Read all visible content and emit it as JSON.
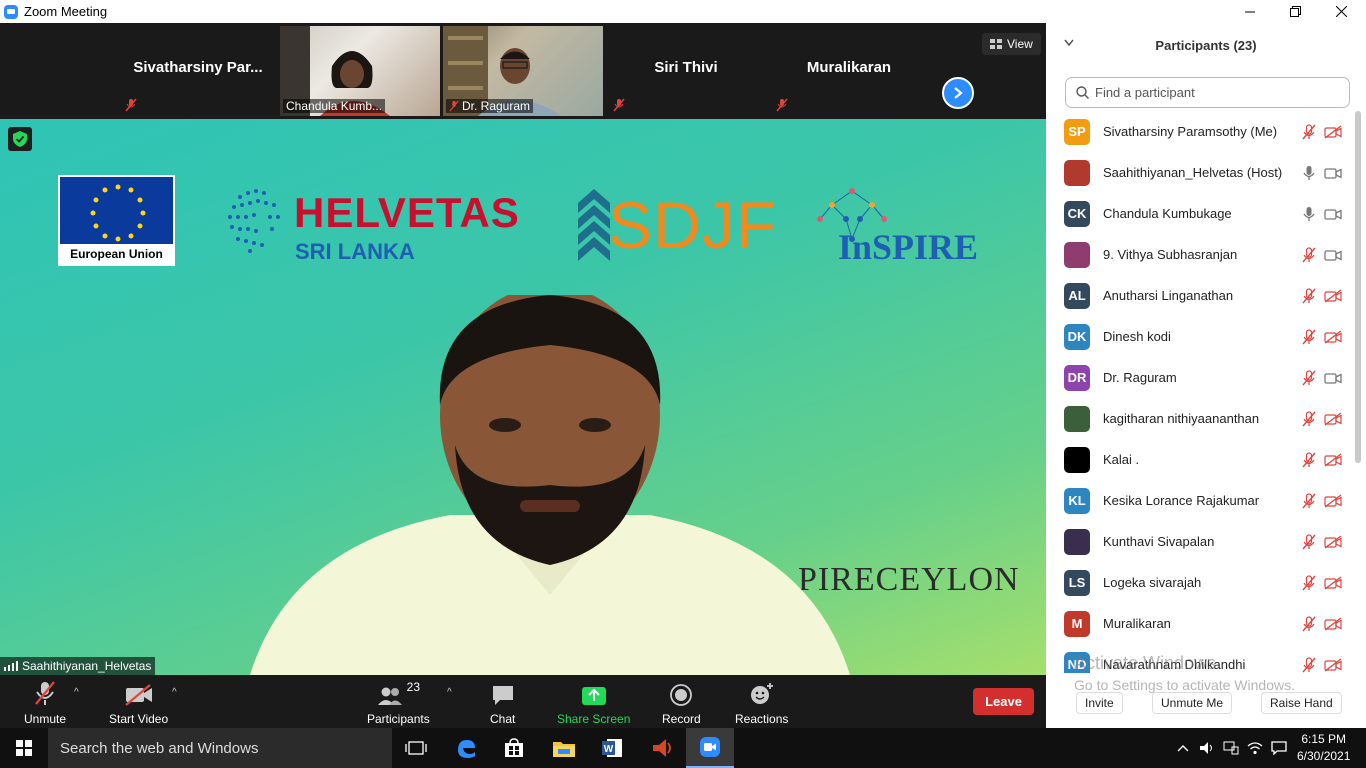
{
  "window": {
    "title": "Zoom Meeting"
  },
  "strip": {
    "tiles": [
      {
        "name": "Sivatharsiny  Par..."
      },
      {
        "label": "Chandula Kumb..."
      },
      {
        "label": "Dr. Raguram"
      },
      {
        "name": "Siri Thivi"
      },
      {
        "name": "Muralikaran"
      }
    ],
    "view_label": "View"
  },
  "stage": {
    "eu_label": "European Union",
    "helvetas_title": "HELVETAS",
    "helvetas_sub": "SRI LANKA",
    "sdjf": "SDJF",
    "inspire": "InSPIRE",
    "banner_text": "PIRECEYLON",
    "speaker_name": "Saahithiyanan_Helvetas"
  },
  "toolbar": {
    "unmute": "Unmute",
    "start_video": "Start Video",
    "participants": "Participants",
    "participants_count": "23",
    "chat": "Chat",
    "share_screen": "Share Screen",
    "record": "Record",
    "reactions": "Reactions",
    "leave": "Leave"
  },
  "panel": {
    "title": "Participants (23)",
    "search_placeholder": "Find a participant",
    "participants": [
      {
        "initials": "SP",
        "name": "Sivatharsiny Paramsothy (Me)",
        "color": "#f39c12",
        "mic": "muted",
        "video": "off"
      },
      {
        "initials": "",
        "name": "Saahithiyanan_Helvetas (Host)",
        "color": "#b03a2e",
        "mic": "on",
        "video": "on"
      },
      {
        "initials": "CK",
        "name": "Chandula Kumbukage",
        "color": "#34495e",
        "mic": "on",
        "video": "on"
      },
      {
        "initials": "",
        "name": "9. Vithya Subhasranjan",
        "color": "#8e3d6e",
        "mic": "muted",
        "video": "on"
      },
      {
        "initials": "AL",
        "name": "Anutharsi Linganathan",
        "color": "#34495e",
        "mic": "muted",
        "video": "off"
      },
      {
        "initials": "DK",
        "name": "Dinesh kodi",
        "color": "#2e86c1",
        "mic": "muted",
        "video": "off"
      },
      {
        "initials": "DR",
        "name": "Dr. Raguram",
        "color": "#8e44ad",
        "mic": "muted",
        "video": "on"
      },
      {
        "initials": "",
        "name": "kagitharan nithiyaananthan",
        "color": "#3b5e3b",
        "mic": "muted",
        "video": "off"
      },
      {
        "initials": "",
        "name": "Kalai .",
        "color": "#000000",
        "mic": "muted",
        "video": "off"
      },
      {
        "initials": "KL",
        "name": "Kesika Lorance Rajakumar",
        "color": "#2e86c1",
        "mic": "muted",
        "video": "off"
      },
      {
        "initials": "",
        "name": "Kunthavi Sivapalan",
        "color": "#3a2e4e",
        "mic": "muted",
        "video": "off"
      },
      {
        "initials": "LS",
        "name": "Logeka sivarajah",
        "color": "#34495e",
        "mic": "muted",
        "video": "off"
      },
      {
        "initials": "M",
        "name": "Muralikaran",
        "color": "#c0392b",
        "mic": "muted",
        "video": "off"
      },
      {
        "initials": "ND",
        "name": "Navarathnam Dhilkandhi",
        "color": "#2e86c1",
        "mic": "muted",
        "video": "off"
      }
    ],
    "invite": "Invite",
    "unmute_me": "Unmute Me",
    "raise_hand": "Raise Hand",
    "watermark_title": "Activate Windows",
    "watermark_sub": "Go to Settings to activate Windows."
  },
  "taskbar": {
    "search_placeholder": "Search the web and Windows",
    "time": "6:15 PM",
    "date": "6/30/2021"
  },
  "colors": {
    "accent": "#2d8cff",
    "leave": "#d32f2f",
    "muted": "#e0443e"
  }
}
